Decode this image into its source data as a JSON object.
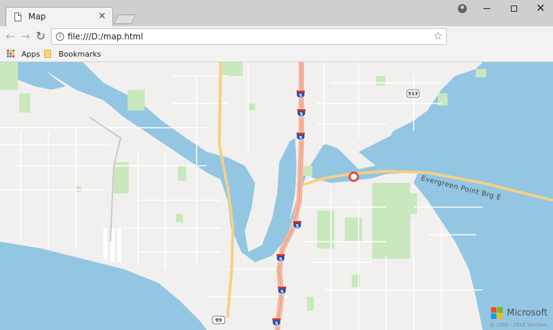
{
  "browser": {
    "tab_title": "Map",
    "tab_close": "×",
    "url": "file:///D:/map.html",
    "info_glyph": "i",
    "bookmarks": {
      "apps_label": "Apps",
      "folder_label": "Bookmarks"
    },
    "window_controls": {
      "close": "✕"
    }
  },
  "map": {
    "highway_shields": [
      "5",
      "5",
      "5",
      "5",
      "5",
      "5",
      "5"
    ],
    "route_513": "513",
    "route_99": "99",
    "road_label": "Evergreen Point Brg E",
    "provider": "Microsoft",
    "copyright": "© 1992 - 2018 TomTom",
    "colors": {
      "water": "#92c6e3",
      "land": "#f1f0ee",
      "park": "#c9e8be",
      "freeway": "#f3b6a0",
      "highway": "#f7cf83",
      "shield": "#2b4fa3"
    }
  }
}
